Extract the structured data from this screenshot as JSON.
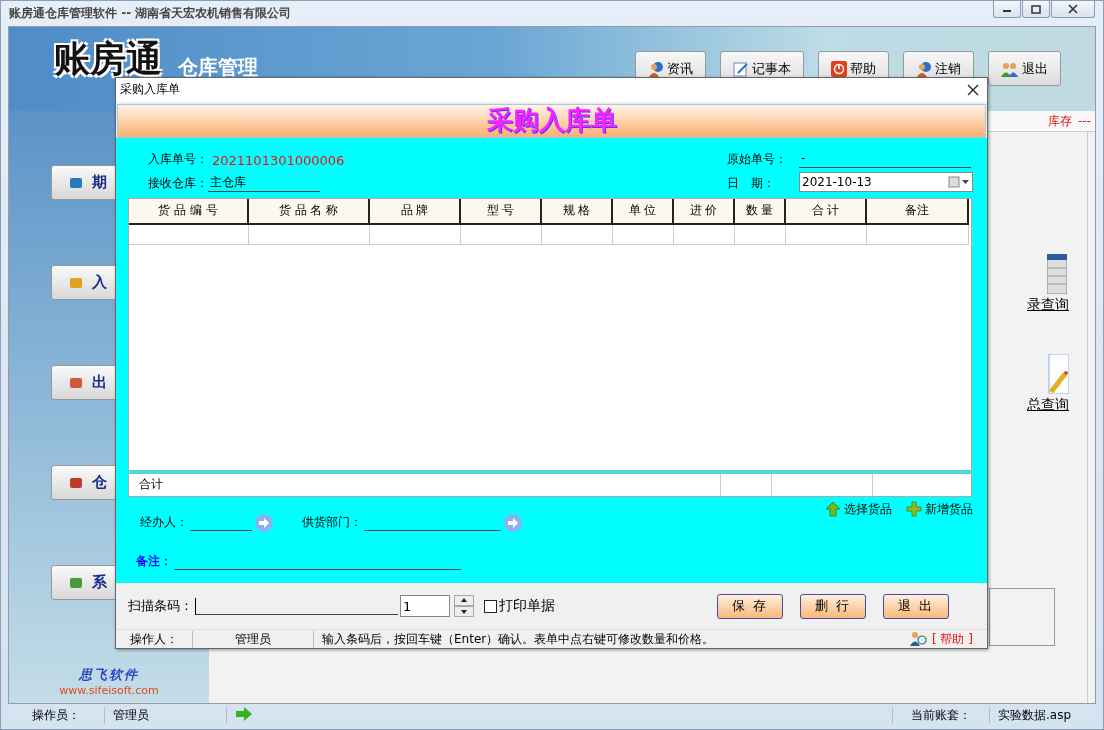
{
  "window": {
    "title": "账房通仓库管理软件 -- 湖南省天宏农机销售有限公司"
  },
  "toolbar": [
    {
      "label": "资讯"
    },
    {
      "label": "记事本"
    },
    {
      "label": "帮助"
    },
    {
      "label": "注销"
    },
    {
      "label": "退出"
    }
  ],
  "logo": {
    "name": "账房通",
    "subtitle": "仓库管理"
  },
  "sidebar": {
    "items": [
      {
        "label": "期"
      },
      {
        "label": "入"
      },
      {
        "label": "出"
      },
      {
        "label": "仓"
      },
      {
        "label": "系"
      }
    ],
    "brand": "思飞软件",
    "url": "www.sifeisoft.com"
  },
  "stock_strip": {
    "label": "库存",
    "value": "---"
  },
  "shortcuts": [
    {
      "label": "录查询"
    },
    {
      "label": "总查询"
    }
  ],
  "dialog": {
    "title": "采购入库单",
    "heading": "采购入库单",
    "receipt_no_label": "入库单号：",
    "receipt_no": "2021101301000006",
    "warehouse_label": "接收仓库：",
    "warehouse": "主仓库",
    "original_no_label": "原始单号：",
    "original_no": "-",
    "date_label": "日　期：",
    "date": "2021-10-13",
    "table": {
      "columns": [
        "货 品 编 号",
        "货 品 名 称",
        "品 牌",
        "型 号",
        "规 格",
        "单 位",
        "进 价",
        "数 量",
        "合 计",
        "备注"
      ],
      "total_label": "合计"
    },
    "handler_label": "经办人：",
    "supplier_label": "供货部门：",
    "actions": [
      {
        "label": "选择货品"
      },
      {
        "label": "新增货品"
      }
    ],
    "remark_label": "备注：",
    "scan_label": "扫描条码：",
    "quantity": "1",
    "print": {
      "label": "打印单据",
      "checked": false
    },
    "buttons": [
      "保 存",
      "删 行",
      "退 出"
    ],
    "status": {
      "operator_label": "操作人：",
      "operator": "管理员",
      "hint": "输入条码后，按回车键（Enter）确认。表单中点右键可修改数量和价格。",
      "help": "[ 帮助 ]"
    }
  },
  "status_bar": {
    "operator_label": "操作员：",
    "operator": "管理员",
    "account_label": "当前账套：",
    "account": "实验数据.asp"
  }
}
